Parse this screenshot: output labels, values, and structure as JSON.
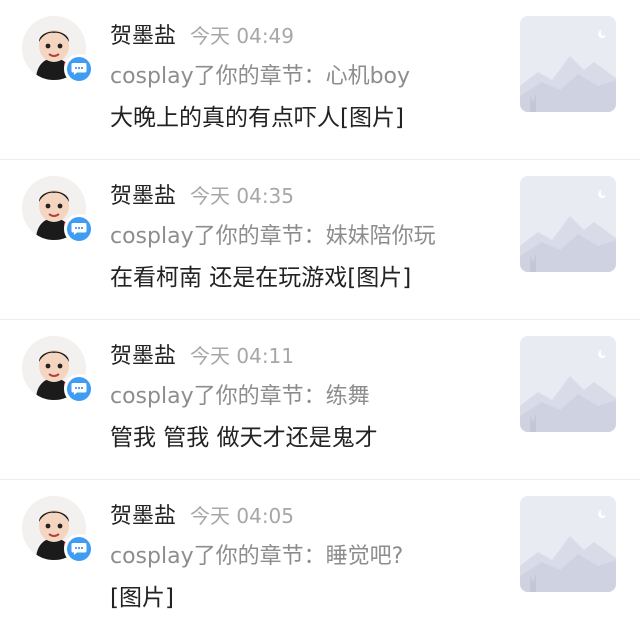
{
  "comments": [
    {
      "user": "贺墨盐",
      "time": "今天 04:49",
      "chapter": "cosplay了你的章节：心机boy",
      "content": "大晚上的真的有点吓人[图片]"
    },
    {
      "user": "贺墨盐",
      "time": "今天 04:35",
      "chapter": "cosplay了你的章节：妹妹陪你玩",
      "content": "在看柯南 还是在玩游戏[图片]"
    },
    {
      "user": "贺墨盐",
      "time": "今天 04:11",
      "chapter": "cosplay了你的章节：练舞",
      "content": "管我 管我 做天才还是鬼才"
    },
    {
      "user": "贺墨盐",
      "time": "今天 04:05",
      "chapter": "cosplay了你的章节：睡觉吧?",
      "content": "[图片]"
    }
  ],
  "icons": {
    "badge": "chat-bubble-icon",
    "thumbnail": "image-placeholder-icon"
  },
  "colors": {
    "badge": "#3f9cf2",
    "time": "#a7a7a7",
    "chapter": "#8d8d8d",
    "thumbnail_bg": "#e9ebf3"
  }
}
